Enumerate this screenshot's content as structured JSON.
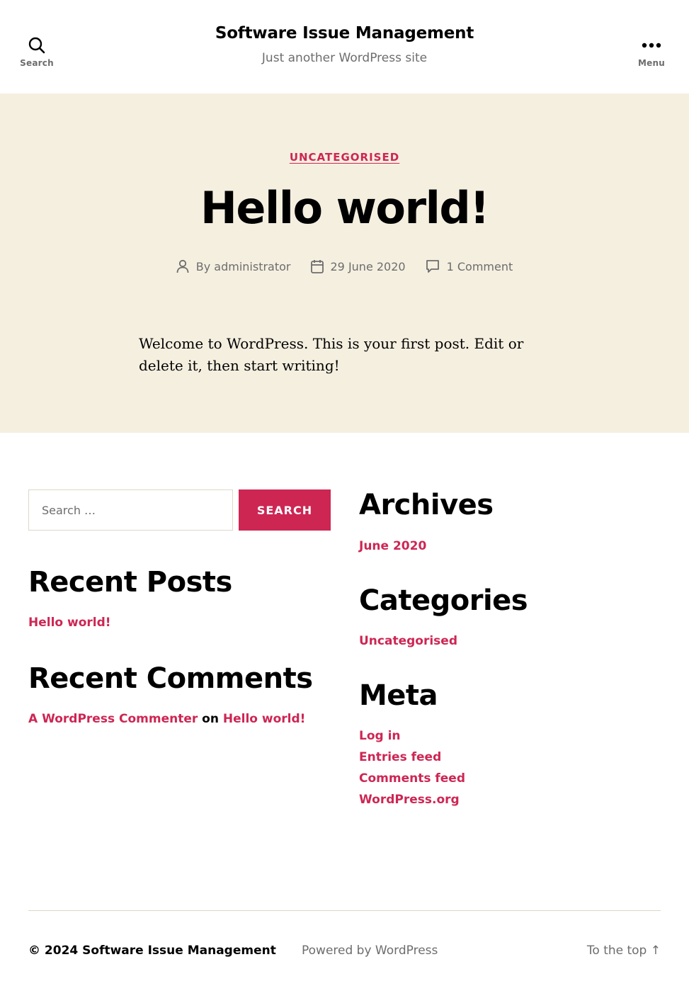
{
  "header": {
    "search_label": "Search",
    "menu_label": "Menu",
    "site_title": "Software Issue Management",
    "site_description": "Just another WordPress site"
  },
  "post": {
    "category": "UNCATEGORISED",
    "title": "Hello world!",
    "author": "By administrator",
    "date": "29 June 2020",
    "comments": "1 Comment",
    "content": "Welcome to WordPress. This is your first post. Edit or delete it, then start writing!"
  },
  "widgets": {
    "search": {
      "placeholder": "Search …",
      "button_label": "Search"
    },
    "recent_posts": {
      "title": "Recent Posts",
      "items": [
        "Hello world!"
      ]
    },
    "recent_comments": {
      "title": "Recent Comments",
      "author": "A WordPress Commenter",
      "on_text": "on",
      "post": "Hello world!"
    },
    "archives": {
      "title": "Archives",
      "items": [
        "June 2020"
      ]
    },
    "categories": {
      "title": "Categories",
      "items": [
        "Uncategorised"
      ]
    },
    "meta": {
      "title": "Meta",
      "items": [
        "Log in",
        "Entries feed",
        "Comments feed",
        "WordPress.org"
      ]
    }
  },
  "footer": {
    "copyright": "© 2024 Software Issue Management",
    "powered_by": "Powered by WordPress",
    "to_top": "To the top ↑"
  },
  "colors": {
    "accent": "#cd2653",
    "hero_background": "#f5efe0",
    "muted_text": "#6d6d6d"
  }
}
